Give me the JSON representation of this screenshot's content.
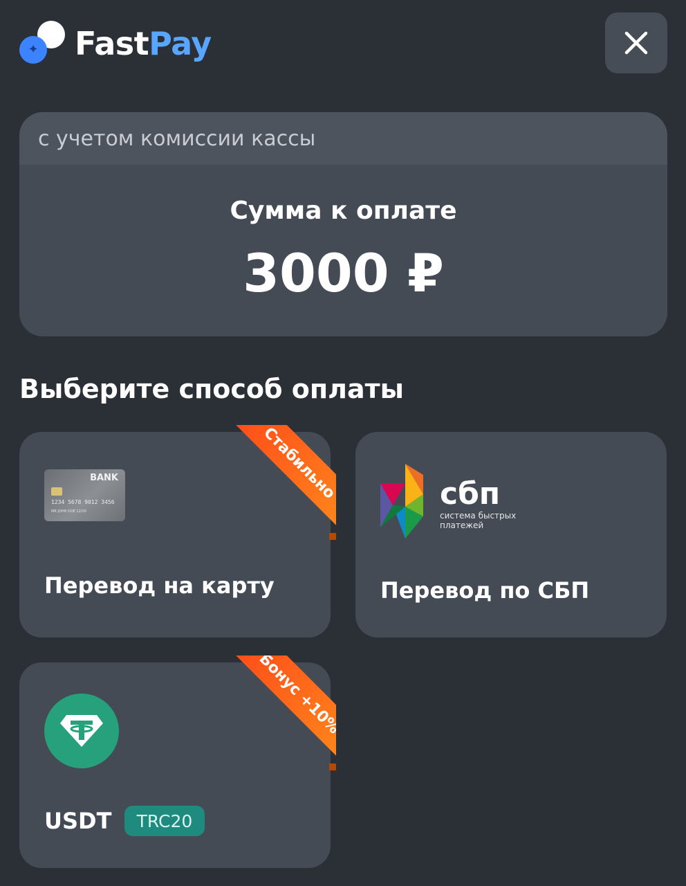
{
  "brand": {
    "name_part1": "Fast",
    "name_part2": "Pay",
    "colors": {
      "primary": "#58a6ff",
      "mark": "#3c84ff"
    }
  },
  "header": {
    "close_icon": "close-icon"
  },
  "amount_card": {
    "note": "с учетом комиссии кассы",
    "label": "Сумма к оплате",
    "value": "3000 ₽"
  },
  "section_title": "Выберите способ оплаты",
  "methods": [
    {
      "label": "Перевод на карту",
      "icon": "bank-card-icon",
      "ribbon": "Стабильно",
      "card_art": {
        "bank": "BANK",
        "number": "1234 5678 9012 3456",
        "holder": "MR JOHN DOE 12/20"
      }
    },
    {
      "label": "Перевод по СБП",
      "icon": "sbp-logo-icon",
      "logo_text": "сбп",
      "logo_caption": [
        "система быстрых",
        "платежей"
      ]
    },
    {
      "label": "USDT",
      "icon": "tether-icon",
      "ribbon": "Бонус +10%",
      "badge": "TRC20"
    }
  ],
  "colors": {
    "background": "#2b2f36",
    "card": "#454b54",
    "ribbon_start": "#ff4a1a",
    "ribbon_end": "#ff8a1a",
    "tether": "#26a17b",
    "trc_badge": "#1f8a7e"
  }
}
